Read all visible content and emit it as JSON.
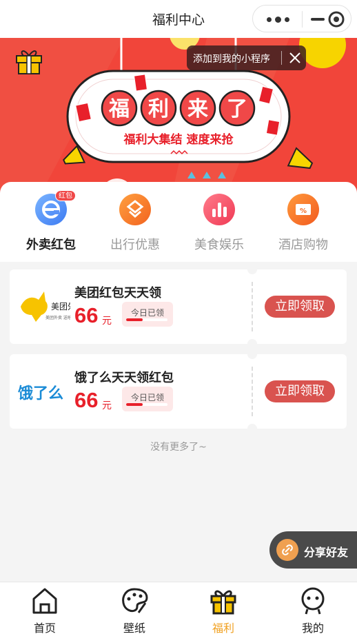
{
  "nav": {
    "title": "福利中心"
  },
  "banner": {
    "headline_chars": [
      "福",
      "利",
      "来",
      "了"
    ],
    "sub_headline": "福利大集结 速度来抢",
    "add_tip": "添加到我的小程序"
  },
  "tabs": [
    {
      "label": "外卖红包",
      "badge": "红包",
      "active": true
    },
    {
      "label": "出行优惠"
    },
    {
      "label": "美食娱乐"
    },
    {
      "label": "酒店购物"
    }
  ],
  "coupons": [
    {
      "name": "美团红包天天领",
      "amount": "66",
      "unit": "元",
      "status": "今日已领",
      "progress": 0.4,
      "button": "立即领取",
      "logo_text": "美团外卖",
      "logo_sub": "美团外卖 送啥都快"
    },
    {
      "name": "饿了么天天领红包",
      "amount": "66",
      "unit": "元",
      "status": "今日已领",
      "progress": 0.4,
      "button": "立即领取",
      "logo_text": "饿了么"
    }
  ],
  "no_more": "没有更多了~",
  "share": {
    "label": "分享好友"
  },
  "tabbar": [
    {
      "label": "首页",
      "icon": "home-icon"
    },
    {
      "label": "壁纸",
      "icon": "palette-icon"
    },
    {
      "label": "福利",
      "icon": "gift-icon",
      "active": true
    },
    {
      "label": "我的",
      "icon": "user-icon"
    }
  ],
  "colors": {
    "brand_red": "#f1453a",
    "price_red": "#e8202a",
    "active_tab": "#f0a020",
    "claim_button": "#d9534f"
  }
}
